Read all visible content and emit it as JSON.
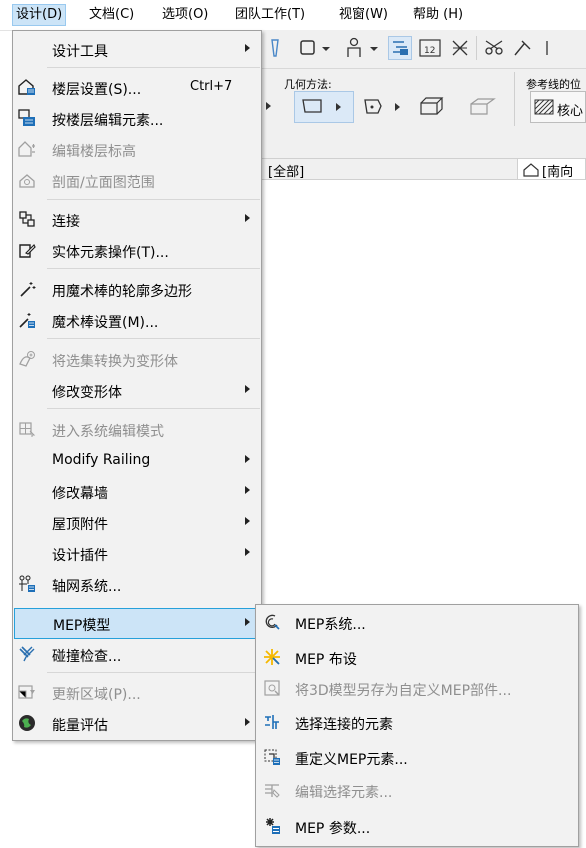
{
  "menubar": {
    "items": [
      {
        "label": "设计(D)",
        "active": true
      },
      {
        "label": "文档(C)"
      },
      {
        "label": "选项(O)"
      },
      {
        "label": "团队工作(T)"
      },
      {
        "label": "视窗(W)"
      },
      {
        "label": "帮助 (H)"
      }
    ]
  },
  "toolbar": {
    "geometry_label": "几何方法:",
    "reference_label": "参考线的位",
    "core_label": "核心",
    "view_tab_all": "[全部]",
    "view_tab_south": "[南向"
  },
  "menu": {
    "items": [
      {
        "label": "设计工具",
        "submenu": true,
        "icon": "none"
      },
      {
        "label": "楼层设置(S)...",
        "shortcut": "Ctrl+7",
        "icon": "floor-settings-icon"
      },
      {
        "label": "按楼层编辑元素...",
        "icon": "edit-by-floor-icon"
      },
      {
        "label": "编辑楼层标高",
        "disabled": true,
        "icon": "edit-floor-level-icon"
      },
      {
        "label": "剖面/立面图范围",
        "disabled": true,
        "icon": "section-range-icon"
      },
      {
        "label": "连接",
        "submenu": true,
        "icon": "connect-icon"
      },
      {
        "label": "实体元素操作(T)...",
        "icon": "solid-element-ops-icon"
      },
      {
        "label": "用魔术棒的轮廓多边形",
        "icon": "magic-wand-icon"
      },
      {
        "label": "魔术棒设置(M)...",
        "icon": "magic-wand-settings-icon"
      },
      {
        "label": "将选集转换为变形体",
        "disabled": true,
        "icon": "convert-to-morph-icon"
      },
      {
        "label": "修改变形体",
        "submenu": true,
        "icon": "none"
      },
      {
        "label": "进入系统编辑模式",
        "disabled": true,
        "icon": "system-edit-mode-icon"
      },
      {
        "label": "Modify Railing",
        "submenu": true,
        "icon": "none"
      },
      {
        "label": "修改幕墙",
        "submenu": true,
        "icon": "none"
      },
      {
        "label": "屋顶附件",
        "submenu": true,
        "icon": "none"
      },
      {
        "label": "设计插件",
        "submenu": true,
        "icon": "none"
      },
      {
        "label": "轴网系统...",
        "icon": "grid-system-icon"
      },
      {
        "label": "MEP模型",
        "submenu": true,
        "highlight": true,
        "icon": "none"
      },
      {
        "label": "碰撞检查...",
        "icon": "collision-check-icon"
      },
      {
        "label": "更新区域(P)...",
        "disabled": true,
        "icon": "update-zones-icon"
      },
      {
        "label": "能量评估",
        "submenu": true,
        "icon": "energy-evaluation-icon"
      }
    ]
  },
  "submenu": {
    "items": [
      {
        "label": "MEP系统...",
        "icon": "mep-systems-icon"
      },
      {
        "label": "MEP 布设",
        "icon": "mep-routing-icon"
      },
      {
        "label": "将3D模型另存为自定义MEP部件...",
        "disabled": true,
        "icon": "save-mep-part-icon"
      },
      {
        "label": "选择连接的元素",
        "icon": "select-connected-icon"
      },
      {
        "label": "重定义MEP元素...",
        "icon": "redefine-mep-icon"
      },
      {
        "label": "编辑选择元素...",
        "disabled": true,
        "icon": "edit-selection-icon"
      },
      {
        "label": "MEP 参数...",
        "icon": "mep-preferences-icon"
      }
    ]
  },
  "colors": {
    "highlight": "#cce4f7",
    "highlight_border": "#26a0da",
    "disabled_text": "#8f8f8f",
    "menu_bg": "#f2f2f2"
  }
}
